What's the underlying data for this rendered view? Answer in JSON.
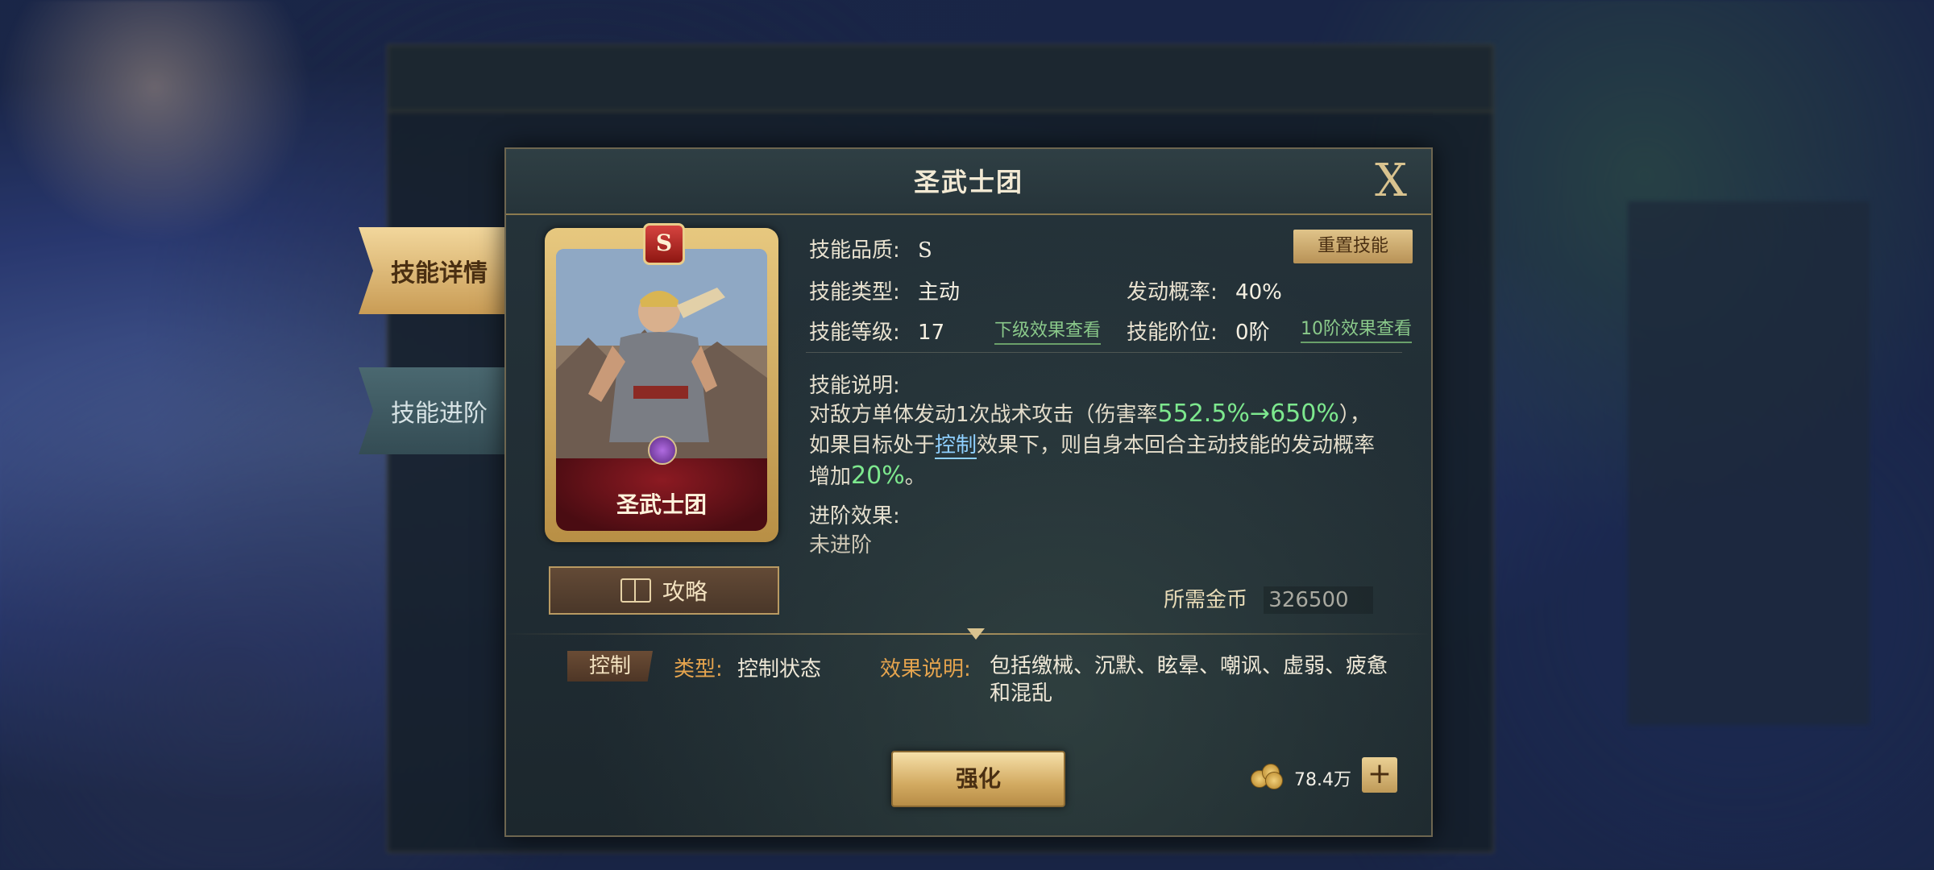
{
  "dialog": {
    "title": "圣武士团",
    "close_label": "X"
  },
  "tabs": [
    {
      "label": "技能详情"
    },
    {
      "label": "技能进阶"
    }
  ],
  "card": {
    "rank": "S",
    "name": "圣武士团"
  },
  "guide_label": "攻略",
  "reset_label": "重置技能",
  "info": {
    "quality_label": "技能品质:",
    "quality_value": "S",
    "type_label": "技能类型:",
    "type_value": "主动",
    "chance_label": "发动概率:",
    "chance_value": "40%",
    "level_label": "技能等级:",
    "level_value": "17",
    "next_effect_link": "下级效果查看",
    "tier_label": "技能阶位:",
    "tier_value": "0阶",
    "tier10_link": "10阶效果查看",
    "desc_label": "技能说明:",
    "desc_part1": "对敌方单体发动1次战术攻击（伤害率",
    "desc_hl1": "552.5%→650%",
    "desc_part2": "），如果目标处于",
    "desc_keyword": "控制",
    "desc_part3": "效果下，则自身本回合主动技能的发动概率增加",
    "desc_hl2": "20%",
    "desc_part4": "。",
    "advance_label": "进阶效果:",
    "advance_value": "未进阶",
    "gold_label": "所需金币",
    "gold_value": "326500"
  },
  "keyword_strip": {
    "tag": "控制",
    "type_label": "类型:",
    "type_value": "控制状态",
    "effect_label": "效果说明:",
    "effect_value": "包括缴械、沉默、眩晕、嘲讽、虚弱、疲惫和混乱"
  },
  "enhance_label": "强化",
  "currency": {
    "amount": "78.4万",
    "plus": "+"
  },
  "colors": {
    "accent_gold": "#d2aa61",
    "highlight_green": "#7de88e",
    "keyword_blue": "#8fd0ff",
    "label_orange": "#e5a44e"
  }
}
